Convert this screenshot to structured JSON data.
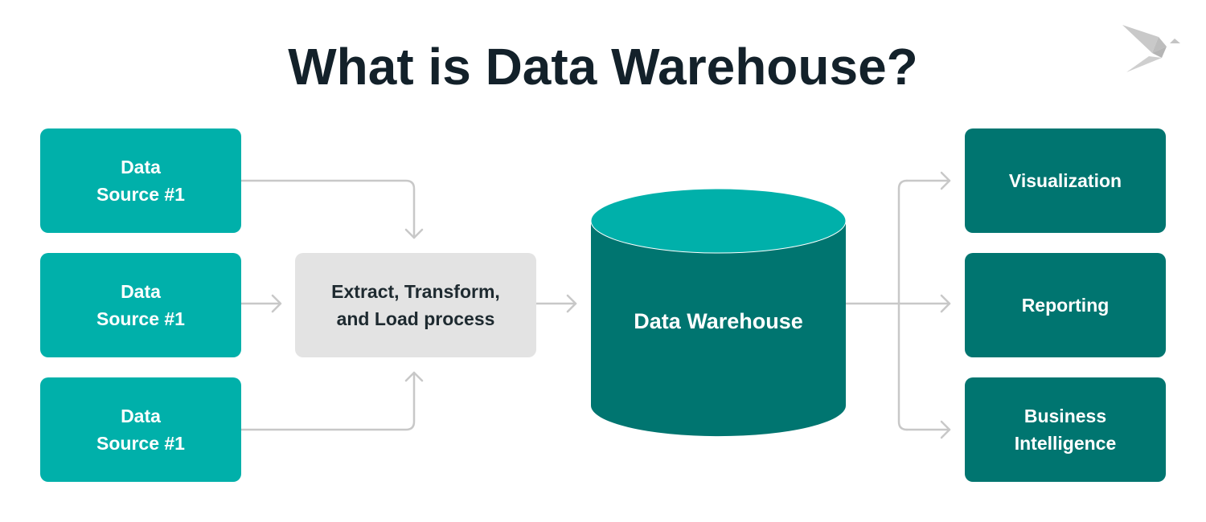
{
  "title": "What is Data Warehouse?",
  "sources": [
    {
      "line1": "Data",
      "line2": "Source #1"
    },
    {
      "line1": "Data",
      "line2": "Source #1"
    },
    {
      "line1": "Data",
      "line2": "Source #1"
    }
  ],
  "etl": {
    "line1": "Extract, Transform,",
    "line2": "and Load process"
  },
  "warehouse": {
    "label": "Data Warehouse"
  },
  "outputs": [
    {
      "line1": "Visualization",
      "line2": ""
    },
    {
      "line1": "Reporting",
      "line2": ""
    },
    {
      "line1": "Business",
      "line2": "Intelligence"
    }
  ],
  "colors": {
    "source": "#00b0aa",
    "output": "#007570",
    "etl": "#e3e3e3",
    "connector": "#c8c8c8",
    "title": "#13212a"
  },
  "logo": {
    "icon": "origami-bird-icon"
  }
}
